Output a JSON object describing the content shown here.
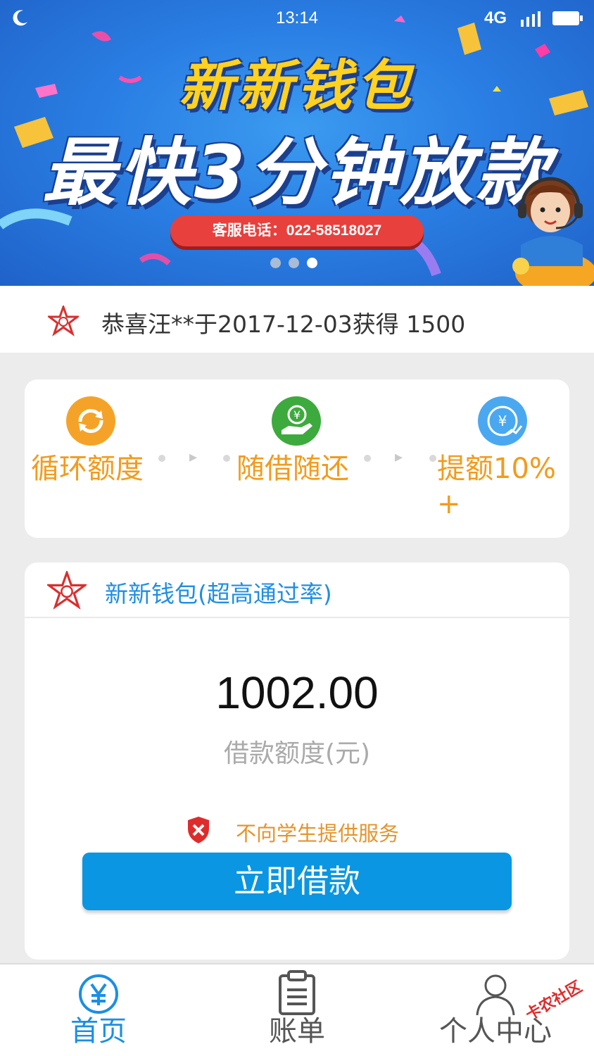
{
  "status_bar": {
    "time": "13:14",
    "network": "4G"
  },
  "banner": {
    "title": "新新钱包",
    "subtitle": "最快3分钟放款",
    "phone": "客服电话：022-58518027",
    "carousel_pages": 3,
    "carousel_active": 3,
    "colors": {
      "background": "#2a7fe4",
      "title": "#ffd21f",
      "phone_pill": "#e8403d"
    }
  },
  "notice": {
    "text": "恭喜汪**于2017-12-03获得 1500"
  },
  "features": [
    {
      "label": "循环额度",
      "icon": "refresh-icon",
      "color": "#f5a328"
    },
    {
      "label": "随借随还",
      "icon": "yen-hand-icon",
      "color": "#3daa3d"
    },
    {
      "label": "提额10%+",
      "icon": "yen-growth-icon",
      "color": "#4aa8f0"
    }
  ],
  "product": {
    "title": "新新钱包(超高通过率)",
    "amount": "1002.00",
    "amount_label": "借款额度(元)",
    "warning": "不向学生提供服务",
    "button": "立即借款",
    "colors": {
      "title": "#1f8ee3",
      "button": "#0a96e2",
      "warning": "#e5942c"
    }
  },
  "tabs": [
    {
      "label": "首页",
      "icon": "yen-circle-icon",
      "active": true
    },
    {
      "label": "账单",
      "icon": "clipboard-icon",
      "active": false
    },
    {
      "label": "个人中心",
      "icon": "person-icon",
      "active": false
    }
  ],
  "watermark": "卡农社区",
  "active_tab_color": "#1a8fe3"
}
